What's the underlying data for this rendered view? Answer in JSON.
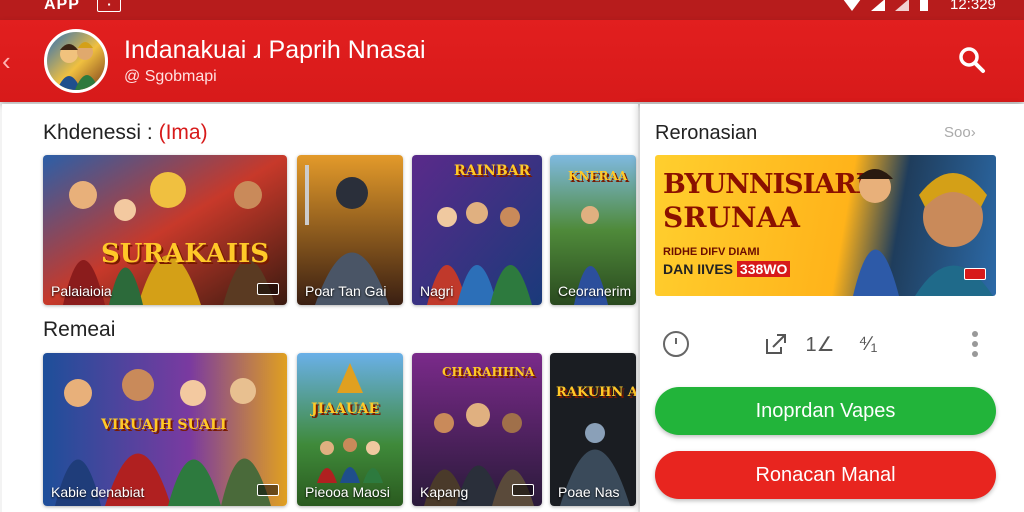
{
  "status_bar": {
    "app": "APP",
    "time": "12:329"
  },
  "header": {
    "title": "Indanakuai ɹ Paprih Nnasai",
    "subtitle": "@ Sgobmapi",
    "icons": {
      "back": "chevron-left-icon",
      "search": "search-icon"
    }
  },
  "section1": {
    "title": "Khdenessi : ",
    "accent": "(Ima)",
    "cards": [
      {
        "label": "Palaiaioia",
        "logo": "SURAKAIIS"
      },
      {
        "label": "Poar Tan Gai"
      },
      {
        "label": "Nagri",
        "logo": "RAINBAR"
      },
      {
        "label": "Ceoranerim",
        "logo": "KNERAA"
      }
    ]
  },
  "section2": {
    "title": "Remeai",
    "cards": [
      {
        "label": "Kabie denabiat",
        "logo": "VIRUAJH SUALI"
      },
      {
        "label": "Pieooa Maosi",
        "logo": "JIAAUAE"
      },
      {
        "label": "Kapang",
        "logo": "CHARAHHNA"
      },
      {
        "label": "Poae Nas",
        "logo": "RAKUHN ADA"
      }
    ]
  },
  "side": {
    "title": "Reronasian",
    "more": "Soo›",
    "banner": {
      "title1": "BYUNNISIARI",
      "title2": "SRUNAA",
      "sub": "RIDHE DIFV DIAMI",
      "cta_prefix": "DAN IIVES ",
      "price": "338",
      "price_suffix": "WO"
    },
    "action_labels": [
      "1∠",
      "⁴∕₁"
    ],
    "buttons": {
      "primary": "Inoprdan Vapes",
      "secondary": "Ronacan Manal"
    }
  },
  "colors": {
    "brand_red": "#d71a1a",
    "green": "#22b43a"
  }
}
